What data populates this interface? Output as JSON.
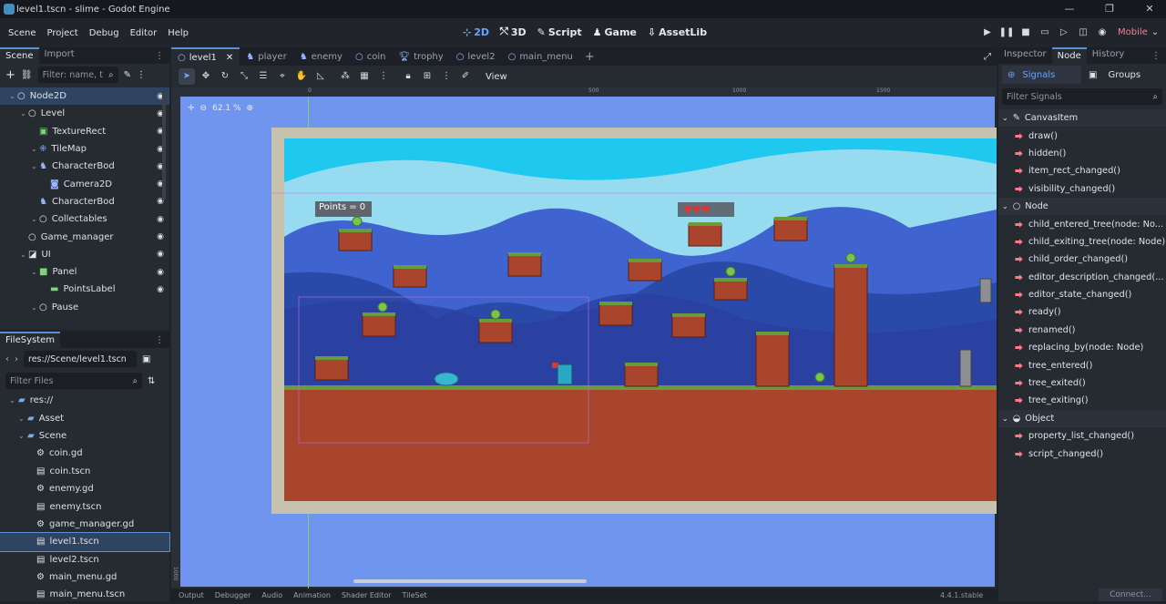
{
  "window": {
    "title": "level1.tscn - slime - Godot Engine"
  },
  "menu": [
    "Scene",
    "Project",
    "Debug",
    "Editor",
    "Help"
  ],
  "workspaces": [
    {
      "label": "2D",
      "active": true
    },
    {
      "label": "3D",
      "active": false
    },
    {
      "label": "Script",
      "active": false
    },
    {
      "label": "Game",
      "active": false
    },
    {
      "label": "AssetLib",
      "active": false
    }
  ],
  "renderer": "Mobile",
  "scene_dock": {
    "tabs": [
      "Scene",
      "Import"
    ],
    "filter_placeholder": "Filter: name, t",
    "tree": [
      {
        "label": "Node2D",
        "depth": 0,
        "icon": "circle-icon",
        "selected": true
      },
      {
        "label": "Level",
        "depth": 1,
        "icon": "circle-icon"
      },
      {
        "label": "TextureRect",
        "depth": 2,
        "icon": "texture-rect-icon"
      },
      {
        "label": "TileMap",
        "depth": 2,
        "icon": "tilemap-icon"
      },
      {
        "label": "CharacterBod",
        "depth": 2,
        "icon": "character-body-icon"
      },
      {
        "label": "Camera2D",
        "depth": 3,
        "icon": "camera-icon"
      },
      {
        "label": "CharacterBod",
        "depth": 2,
        "icon": "character-body-icon"
      },
      {
        "label": "Collectables",
        "depth": 2,
        "icon": "circle-icon"
      },
      {
        "label": "Game_manager",
        "depth": 1,
        "icon": "circle-icon"
      },
      {
        "label": "UI",
        "depth": 1,
        "icon": "canvas-layer-icon"
      },
      {
        "label": "Panel",
        "depth": 2,
        "icon": "panel-icon"
      },
      {
        "label": "PointsLabel",
        "depth": 3,
        "icon": "label-icon"
      },
      {
        "label": "Pause",
        "depth": 2,
        "icon": "circle-icon"
      }
    ]
  },
  "filesystem": {
    "tab": "FileSystem",
    "path": "res://Scene/level1.tscn",
    "filter_placeholder": "Filter Files",
    "items": [
      {
        "label": "res://",
        "depth": 0,
        "icon": "folder-icon"
      },
      {
        "label": "Asset",
        "depth": 1,
        "icon": "folder-icon"
      },
      {
        "label": "Scene",
        "depth": 1,
        "icon": "folder-icon"
      },
      {
        "label": "coin.gd",
        "depth": 2,
        "icon": "gear-icon"
      },
      {
        "label": "coin.tscn",
        "depth": 2,
        "icon": "clapper-icon"
      },
      {
        "label": "enemy.gd",
        "depth": 2,
        "icon": "gear-icon"
      },
      {
        "label": "enemy.tscn",
        "depth": 2,
        "icon": "clapper-icon"
      },
      {
        "label": "game_manager.gd",
        "depth": 2,
        "icon": "gear-icon"
      },
      {
        "label": "level1.tscn",
        "depth": 2,
        "icon": "clapper-icon",
        "selected": true
      },
      {
        "label": "level2.tscn",
        "depth": 2,
        "icon": "clapper-icon"
      },
      {
        "label": "main_menu.gd",
        "depth": 2,
        "icon": "gear-icon"
      },
      {
        "label": "main_menu.tscn",
        "depth": 2,
        "icon": "clapper-icon"
      }
    ]
  },
  "editor_tabs": [
    "level1",
    "player",
    "enemy",
    "coin",
    "trophy",
    "level2",
    "main_menu"
  ],
  "canvas": {
    "view_menu": "View",
    "zoom": "62.1 %",
    "ruler_labels": [
      "0",
      "500",
      "1000",
      "1500"
    ],
    "vruler_label": "1000",
    "points_label": "Points = 0"
  },
  "bottom_tabs": [
    "Output",
    "Debugger",
    "Audio",
    "Animation",
    "Shader Editor",
    "TileSet"
  ],
  "version": "4.4.1.stable",
  "inspector": {
    "tabs": [
      "Inspector",
      "Node",
      "History"
    ],
    "subtabs": [
      "Signals",
      "Groups"
    ],
    "filter_placeholder": "Filter Signals",
    "signals": [
      {
        "label": "CanvasItem",
        "header": true
      },
      {
        "label": "draw()"
      },
      {
        "label": "hidden()"
      },
      {
        "label": "item_rect_changed()"
      },
      {
        "label": "visibility_changed()"
      },
      {
        "label": "Node",
        "header": true
      },
      {
        "label": "child_entered_tree(node: No..."
      },
      {
        "label": "child_exiting_tree(node: Node)"
      },
      {
        "label": "child_order_changed()"
      },
      {
        "label": "editor_description_changed(..."
      },
      {
        "label": "editor_state_changed()"
      },
      {
        "label": "ready()"
      },
      {
        "label": "renamed()"
      },
      {
        "label": "replacing_by(node: Node)"
      },
      {
        "label": "tree_entered()"
      },
      {
        "label": "tree_exited()"
      },
      {
        "label": "tree_exiting()"
      },
      {
        "label": "Object",
        "header": true
      },
      {
        "label": "property_list_changed()"
      },
      {
        "label": "script_changed()"
      }
    ],
    "connect_label": "Connect..."
  },
  "colors": {
    "accent": "#5a8fd6",
    "viewport_bg": "#6f95ef",
    "sky": "#1ec8ef",
    "dirt": "#a9452c",
    "grass": "#6b9a3b"
  }
}
